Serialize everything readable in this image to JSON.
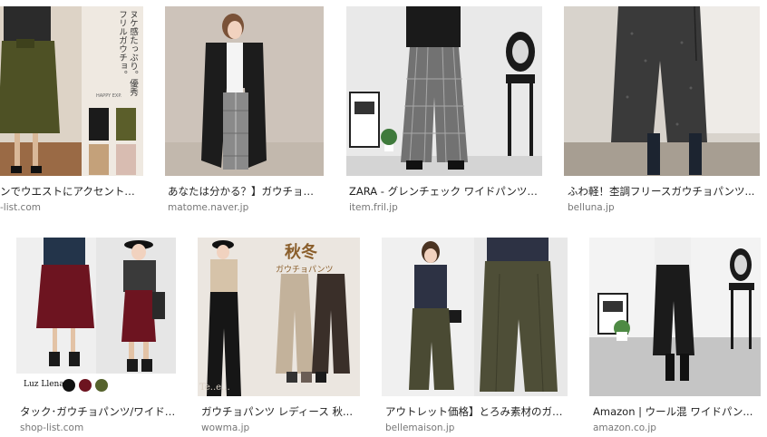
{
  "results": [
    {
      "caption": "ンでウエストにアクセント。リ...",
      "domain": "-list.com",
      "overlay": {
        "line1": "ヌケ感たっぷり。",
        "line2": "優秀フリルガウチョ。",
        "tag": "HAPPY EXP."
      }
    },
    {
      "caption": "あなたは分かる？】ガウチョ、...",
      "domain": "matome.naver.jp"
    },
    {
      "caption": "ZARA - グレンチェック ワイドパンツ ...",
      "domain": "item.fril.jp"
    },
    {
      "caption": "ふわ軽！杢調フリースガウチョパンツ...",
      "domain": "belluna.jp"
    },
    {
      "caption": "タック･ガウチョパンツ/ワイドパ...",
      "domain": "shop-list.com",
      "overlay": {
        "brand": "Luz Llena"
      }
    },
    {
      "caption": "ガウチョパンツ レディース 秋...",
      "domain": "wowma.jp",
      "overlay": {
        "title": "秋冬",
        "subtitle": "ガウチョパンツ",
        "logo": "Te..e..."
      }
    },
    {
      "caption": "アウトレット価格】とろみ素材のガウ...",
      "domain": "bellemaison.jp"
    },
    {
      "caption": "Amazon | ウール混 ワイドパン...",
      "domain": "amazon.co.jp"
    }
  ],
  "colors": {
    "caption": "#222222",
    "domain": "#777777",
    "olive": "#5b5a2c",
    "burgundy": "#6d1420",
    "black": "#1b1b1b",
    "check": "#6d6d6d",
    "beige": "#c7b8a0"
  }
}
